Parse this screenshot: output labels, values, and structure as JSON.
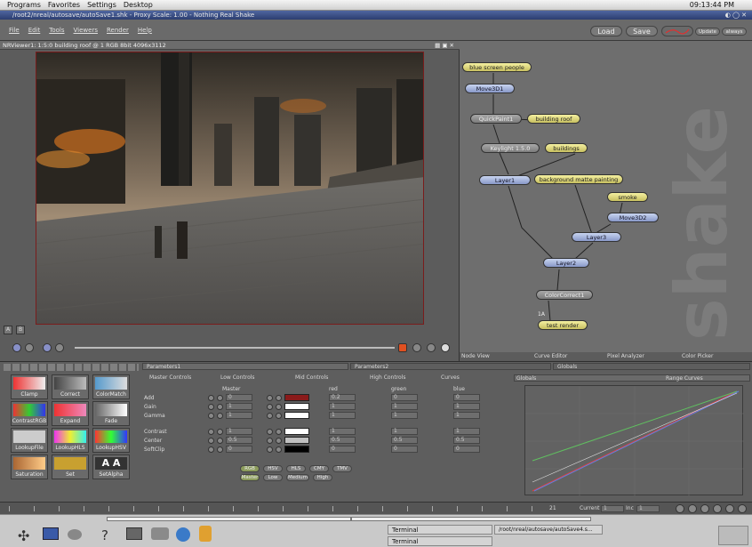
{
  "topbar": {
    "menus": [
      "Programs",
      "Favorites",
      "Settings",
      "Desktop"
    ],
    "clock": "09:13:44 PM"
  },
  "window": {
    "title": "/root2/nreal/autosave/autoSave1.shk - Proxy Scale: 1.00 - Nothing Real Shake"
  },
  "menubar": {
    "items": [
      "File",
      "Edit",
      "Tools",
      "Viewers",
      "Render",
      "Help"
    ],
    "load": "Load",
    "save": "Save",
    "update": "Update",
    "always": "always"
  },
  "viewer": {
    "header": "NRViewer1: 1:5:0  building roof @ 1  RGB  8bit  4096x3112",
    "buttons": [
      "A",
      "B"
    ]
  },
  "nodegraph": {
    "nodes": [
      "blue screen people",
      "Move3D1",
      "QuickPaint1",
      "building roof",
      "Keylight 1.5.0",
      "buildings",
      "Layer1",
      "background matte painting",
      "smoke",
      "Move3D2",
      "Layer3",
      "Layer2",
      "ColorCorrect1",
      "1A",
      "test render"
    ],
    "brand": "shake",
    "tabs": [
      "Node View",
      "Curve Editor",
      "Pixel Analyzer",
      "Color Picker"
    ]
  },
  "tools": [
    {
      "label": "Clamp"
    },
    {
      "label": "Correct"
    },
    {
      "label": "ColorMatch"
    },
    {
      "label": "ContrastRGB"
    },
    {
      "label": "Expand"
    },
    {
      "label": "Fade"
    },
    {
      "label": "LookupFile"
    },
    {
      "label": "LookupHLS"
    },
    {
      "label": "LookupHSV"
    },
    {
      "label": "Saturation"
    },
    {
      "label": "Set"
    },
    {
      "label": "SetAlpha"
    }
  ],
  "params": {
    "tab1": "Parameters1",
    "tab2": "Parameters2",
    "globals": "Globals",
    "subtabs": [
      "Master Controls",
      "Low Controls",
      "Mid Controls",
      "High Controls",
      "Curves"
    ],
    "colhead": [
      "Master",
      "red",
      "green",
      "blue"
    ],
    "rows": [
      {
        "label": "Add",
        "master": "0",
        "red": "0.2",
        "green": "0",
        "blue": "0"
      },
      {
        "label": "Gain",
        "master": "1",
        "red": "1",
        "green": "1",
        "blue": "1"
      },
      {
        "label": "Gamma",
        "master": "1",
        "red": "1",
        "green": "1",
        "blue": "1"
      },
      {
        "label": "Contrast",
        "master": "1",
        "red": "1",
        "green": "1",
        "blue": "1"
      },
      {
        "label": "Center",
        "master": "0.5",
        "red": "0.5",
        "green": "0.5",
        "blue": "0.5"
      },
      {
        "label": "SoftClip",
        "master": "0",
        "red": "0",
        "green": "0",
        "blue": "0"
      }
    ],
    "colorspace": [
      "RGB",
      "HSV",
      "HLS",
      "CMY",
      "TMV"
    ],
    "ranges": [
      "Master",
      "Low",
      "Medium",
      "High"
    ]
  },
  "curves": {
    "globals": "Globals",
    "range": "Range Curves"
  },
  "timeline": {
    "end": "21",
    "current_label": "Current",
    "current": "1",
    "inc_label": "Inc",
    "inc": "1"
  },
  "taskbar": {
    "tasks": [
      "Terminal",
      "Terminal",
      "/root/nreal/autosave/autoSave4.s..."
    ]
  }
}
